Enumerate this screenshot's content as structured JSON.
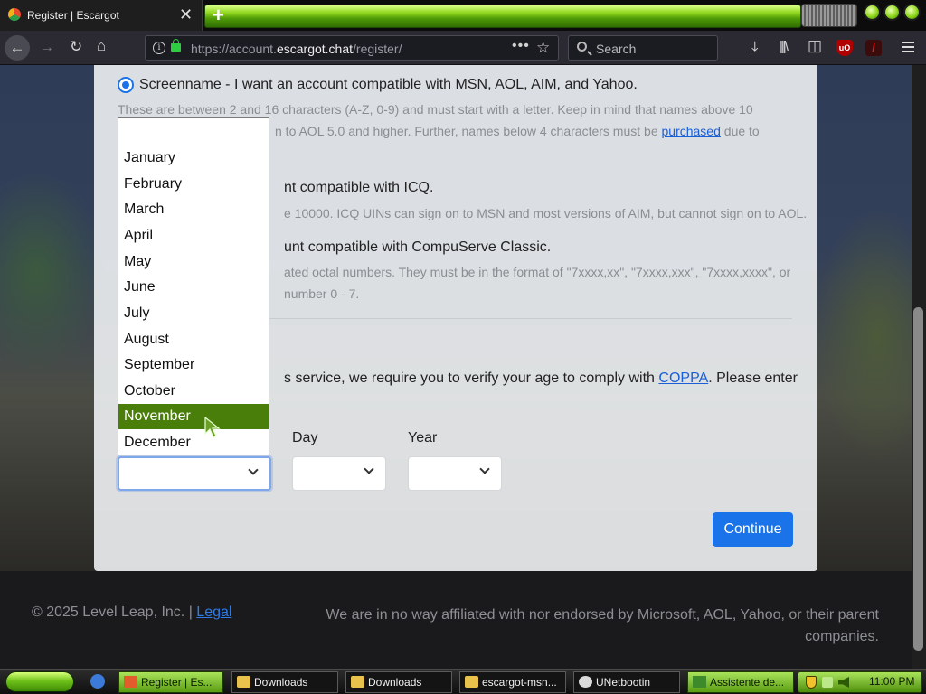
{
  "browser": {
    "tab_title": "Register | Escargot",
    "tab_close": "✕",
    "newtab": "+",
    "url_prefix": "https://account.",
    "url_domain": "escargot.chat",
    "url_path": "/register/",
    "search_placeholder": "Search",
    "ext_ublock": "uO"
  },
  "form": {
    "option_screenname_title": "Screenname - I want an account compatible with MSN, AOL, AIM, and Yahoo.",
    "option_screenname_desc1": "These are between 2 and 16 characters (A-Z, 0-9) and must start with a letter. Keep in mind that names above 10",
    "option_screenname_desc2_tail": "n to AOL 5.0 and higher. Further, names below 4 characters must be",
    "option_screenname_link": "purchased",
    "option_screenname_desc2_end": "due to",
    "option_icq_title_tail": "nt compatible with ICQ.",
    "option_icq_desc_tail": "e 10000. ICQ UINs can sign on to MSN and most versions of AIM, but cannot sign on to AOL.",
    "option_compuserve_title_tail": "unt compatible with CompuServe Classic.",
    "option_compuserve_desc1_tail": "ated octal numbers. They must be in the format of \"7xxxx,xx\", \"7xxxx,xxx\", \"7xxxx,xxxx\", or",
    "option_compuserve_desc2_tail": "number 0 - 7.",
    "coppa_text_tail": "s service, we require you to verify your age to comply with",
    "coppa_link": "COPPA",
    "coppa_text_end": ". Please enter",
    "label_day": "Day",
    "label_year": "Year",
    "continue_label": "Continue"
  },
  "month_dropdown": {
    "options": [
      "January",
      "February",
      "March",
      "April",
      "May",
      "June",
      "July",
      "August",
      "September",
      "October",
      "November",
      "December"
    ],
    "highlighted": "November"
  },
  "footer": {
    "copyright": "© 2025 Level Leap, Inc. |",
    "legal_link": "Legal",
    "disclaimer_line1": "We are in no way affiliated with nor endorsed by Microsoft, AOL, Yahoo, or their parent",
    "disclaimer_line2": "companies."
  },
  "taskbar": {
    "tasks": [
      "Register | Es...",
      "Downloads",
      "Downloads",
      "escargot-msn...",
      "UNetbootin",
      "Assistente de..."
    ],
    "clock": "11:00 PM"
  },
  "colors": {
    "accent_blue": "#1a73e8",
    "dropdown_highlight": "#4a7e0b",
    "theme_green": "#8ed61a"
  }
}
